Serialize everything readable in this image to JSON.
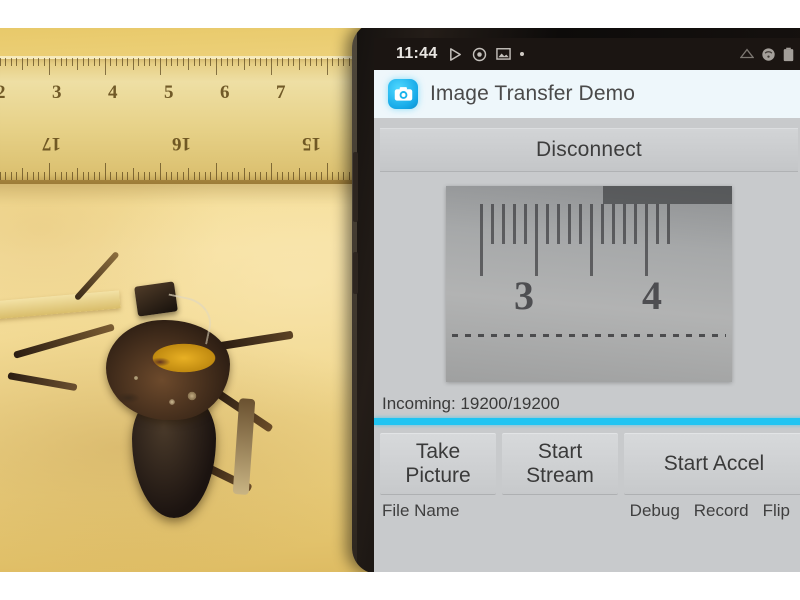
{
  "scene": {
    "description": "Cyborg beetle with electronics backpack photographed beside a ruler, next to a smartphone running the app",
    "ruler_top_numbers": [
      "2",
      "3",
      "4",
      "5",
      "6",
      "7"
    ],
    "ruler_bottom_numbers": [
      "17",
      "16",
      "15"
    ]
  },
  "phone": {
    "statusbar": {
      "clock": "11:44",
      "left_icons": [
        "play-icon",
        "record-icon",
        "screenshot-icon",
        "dot-icon"
      ],
      "right_icons": [
        "signal-icon",
        "wifi-icon",
        "battery-icon"
      ]
    },
    "appbar": {
      "icon": "camera-app-icon",
      "title": "Image Transfer Demo"
    },
    "connection": {
      "button_label": "Disconnect"
    },
    "preview": {
      "alt": "grayscale ruler image received from device",
      "visible_numbers": [
        "3",
        "4"
      ]
    },
    "status": {
      "incoming_label": "Incoming: 19200/19200",
      "progress_percent": 100,
      "progress_color": "#1fc4f2"
    },
    "actions": [
      {
        "label": "Take\nPicture",
        "name": "take-picture-button"
      },
      {
        "label": "Start\nStream",
        "name": "start-stream-button"
      },
      {
        "label": "Start Accel",
        "name": "start-accel-button"
      }
    ],
    "footer": {
      "file_name_label": "File Name",
      "debug_label": "Debug",
      "record_label": "Record",
      "flip_label": "Flip"
    }
  }
}
